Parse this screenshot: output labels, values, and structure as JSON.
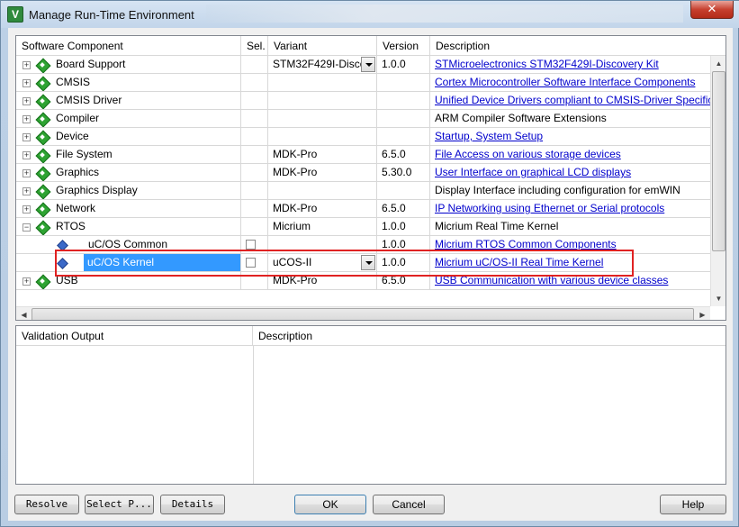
{
  "window": {
    "title": "Manage Run-Time Environment",
    "close_label": "✕"
  },
  "grid": {
    "headers": [
      "Software Component",
      "Sel.",
      "Variant",
      "Version",
      "Description"
    ],
    "rows": [
      {
        "name": "Board Support",
        "sel": "",
        "variant": "STM32F429I-Discov",
        "version": "1.0.0",
        "description": "STMicroelectronics STM32F429I-Discovery Kit",
        "link": true
      },
      {
        "name": "CMSIS",
        "sel": "",
        "variant": "",
        "version": "",
        "description": "Cortex Microcontroller Software Interface Components",
        "link": true
      },
      {
        "name": "CMSIS Driver",
        "sel": "",
        "variant": "",
        "version": "",
        "description": "Unified Device Drivers compliant to CMSIS-Driver Specifica",
        "link": true
      },
      {
        "name": "Compiler",
        "sel": "",
        "variant": "",
        "version": "",
        "description": "ARM Compiler Software Extensions",
        "link": false
      },
      {
        "name": "Device",
        "sel": "",
        "variant": "",
        "version": "",
        "description": "Startup, System Setup",
        "link": true
      },
      {
        "name": "File System",
        "sel": "",
        "variant": "MDK-Pro",
        "version": "6.5.0",
        "description": "File Access on various storage devices",
        "link": true
      },
      {
        "name": "Graphics",
        "sel": "",
        "variant": "MDK-Pro",
        "version": "5.30.0",
        "description": "User Interface on graphical LCD displays",
        "link": true
      },
      {
        "name": "Graphics Display",
        "sel": "",
        "variant": "",
        "version": "",
        "description": "Display Interface including configuration for emWIN",
        "link": false
      },
      {
        "name": "Network",
        "sel": "",
        "variant": "MDK-Pro",
        "version": "6.5.0",
        "description": "IP Networking using Ethernet or Serial protocols",
        "link": true
      },
      {
        "name": "RTOS",
        "sel": "",
        "variant": "Micrium",
        "version": "1.0.0",
        "description": "Micrium Real Time Kernel",
        "link": false
      },
      {
        "name": "uC/OS Common",
        "sel": "",
        "variant": "",
        "version": "1.0.0",
        "description": "Micrium RTOS Common Components",
        "link": true
      },
      {
        "name": "uC/OS Kernel",
        "sel": "",
        "variant": "uCOS-II",
        "version": "1.0.0",
        "description": "Micrium uC/OS-II Real Time Kernel",
        "link": true
      },
      {
        "name": "USB",
        "sel": "",
        "variant": "MDK-Pro",
        "version": "6.5.0",
        "description": "USB Communication with various device classes",
        "link": true
      }
    ]
  },
  "validation": {
    "headers": [
      "Validation Output",
      "Description"
    ]
  },
  "buttons": {
    "resolve": "Resolve",
    "select_p": "Select P...",
    "details": "Details",
    "ok": "OK",
    "cancel": "Cancel",
    "help": "Help"
  },
  "colors": {
    "selection": "#3399ff",
    "highlight_box": "#e02222",
    "link": "#0000cc"
  }
}
